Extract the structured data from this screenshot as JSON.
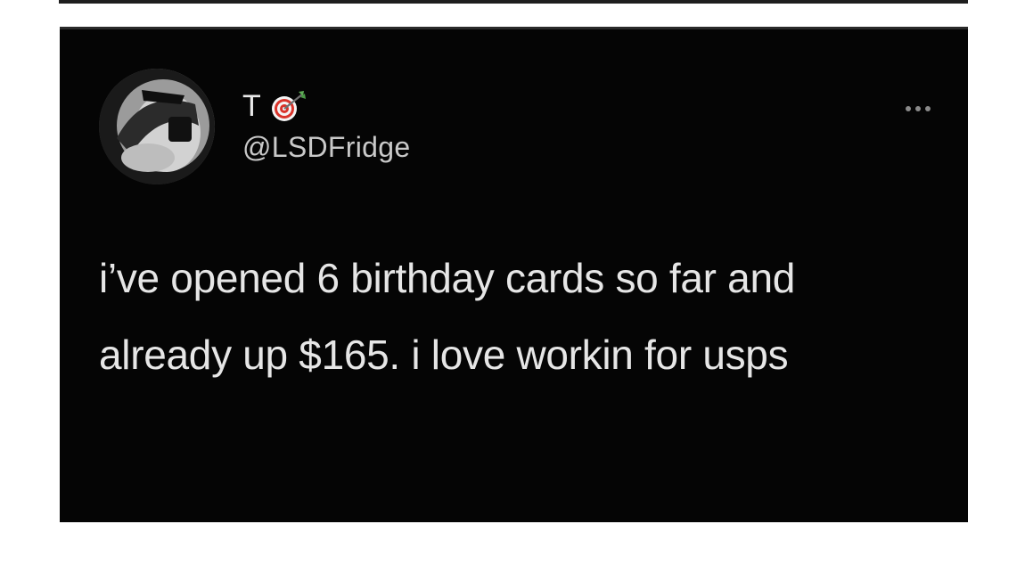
{
  "tweet": {
    "display_name": "T",
    "handle": "@LSDFridge",
    "emoji": "direct-hit-icon",
    "text": "i’ve opened 6 birthday cards so far and already up $165. i love workin for usps"
  },
  "colors": {
    "card_background": "#050505",
    "page_background": "#ffffff",
    "text": "#e6e6e6",
    "secondary_text": "#c9c9c9"
  }
}
